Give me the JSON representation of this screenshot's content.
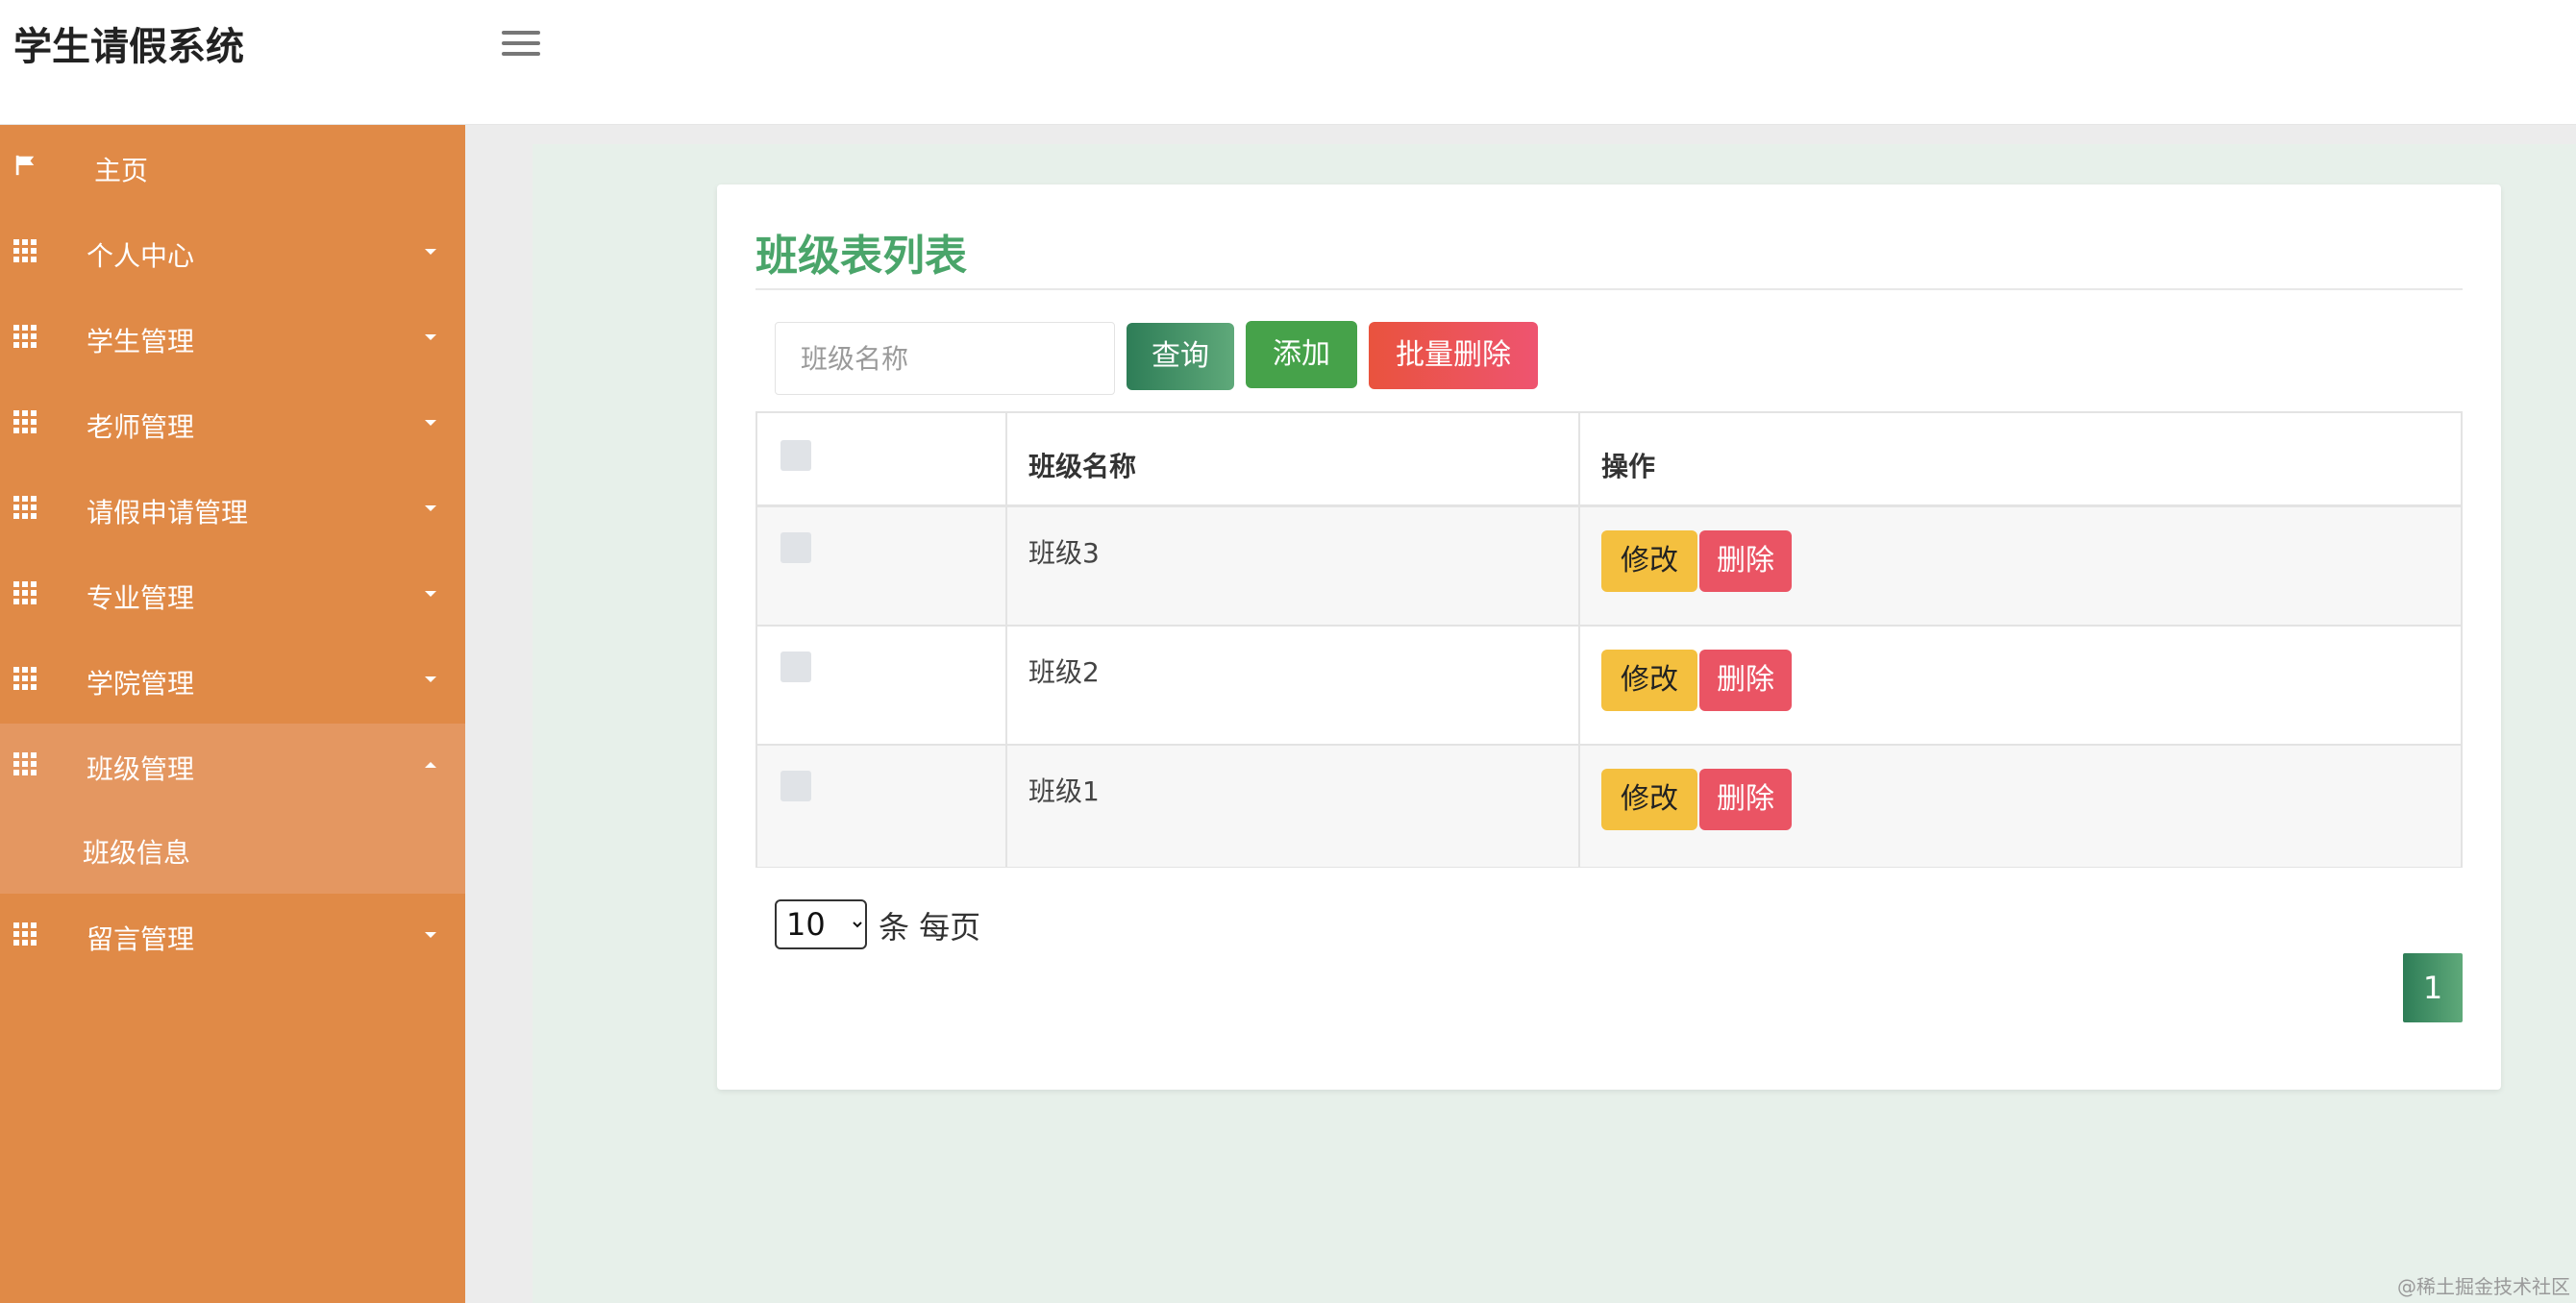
{
  "app": {
    "title": "学生请假系统"
  },
  "sidebar": {
    "items": [
      {
        "label": "主页",
        "icon": "flag-icon"
      },
      {
        "label": "个人中心",
        "icon": "grid-icon"
      },
      {
        "label": "学生管理",
        "icon": "grid-icon"
      },
      {
        "label": "老师管理",
        "icon": "grid-icon"
      },
      {
        "label": "请假申请管理",
        "icon": "grid-icon"
      },
      {
        "label": "专业管理",
        "icon": "grid-icon"
      },
      {
        "label": "学院管理",
        "icon": "grid-icon"
      },
      {
        "label": "班级管理",
        "icon": "grid-icon",
        "expanded": true
      },
      {
        "label": "留言管理",
        "icon": "grid-icon"
      }
    ],
    "submenu": {
      "label": "班级信息"
    }
  },
  "page": {
    "title": "班级表列表",
    "search": {
      "placeholder": "班级名称",
      "value": ""
    },
    "buttons": {
      "query": "查询",
      "add": "添加",
      "batch_delete": "批量删除"
    }
  },
  "table": {
    "columns": [
      "",
      "班级名称",
      "操作"
    ],
    "rows": [
      {
        "name": "班级3"
      },
      {
        "name": "班级2"
      },
      {
        "name": "班级1"
      }
    ],
    "actions": {
      "edit": "修改",
      "delete": "删除"
    }
  },
  "pagination": {
    "page_size": "10",
    "per_page_text": "条 每页",
    "current_page": "1"
  },
  "footer": {
    "watermark": "@稀土掘金技术社区"
  },
  "colors": {
    "sidebar": "#e08a47",
    "sidebar_active": "#e49761",
    "title_green": "#4aa56a",
    "add_green": "#46a24a",
    "danger": "#ea5464",
    "warning": "#f4c03f"
  }
}
